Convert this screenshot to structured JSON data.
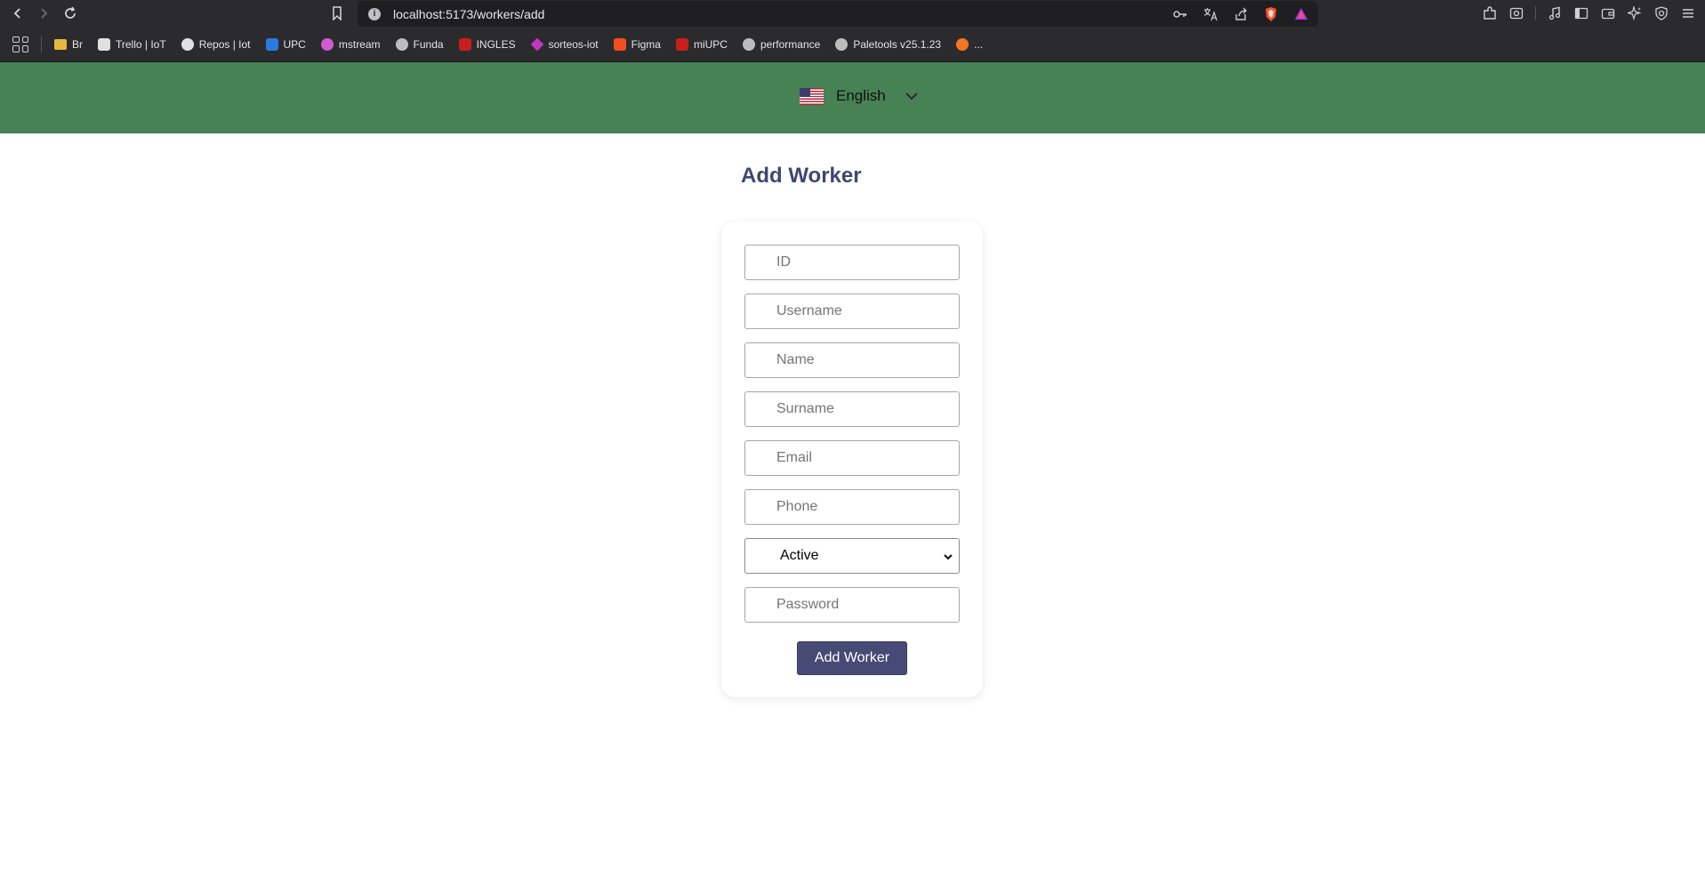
{
  "browser": {
    "url": "localhost:5173/workers/add",
    "bookmarks": [
      {
        "label": "Br",
        "icon": "folder-icon",
        "color": "#e8b83c"
      },
      {
        "label": "Trello | IoT",
        "icon": "trello-icon",
        "color": "#e0e0e0"
      },
      {
        "label": "Repos | Iot",
        "icon": "github-icon",
        "color": "#e0e0e0"
      },
      {
        "label": "UPC",
        "icon": "upc-icon",
        "color": "#2a7ae2"
      },
      {
        "label": "mstream",
        "icon": "mstream-icon",
        "color": "#d05cd0"
      },
      {
        "label": "Funda",
        "icon": "globe-icon",
        "color": "#bdbdbd"
      },
      {
        "label": "INGLES",
        "icon": "upc-red-icon",
        "color": "#c81e1e"
      },
      {
        "label": "sorteos-iot",
        "icon": "diamond-icon",
        "color": "#c236c2"
      },
      {
        "label": "Figma",
        "icon": "figma-icon",
        "color": "#f24e1e"
      },
      {
        "label": "miUPC",
        "icon": "upc-red-icon",
        "color": "#c81e1e"
      },
      {
        "label": "performance",
        "icon": "globe-icon",
        "color": "#bdbdbd"
      },
      {
        "label": "Paletools v25.1.23",
        "icon": "globe-icon",
        "color": "#bdbdbd"
      },
      {
        "label": "...",
        "icon": "crunchyroll-icon",
        "color": "#f47521"
      }
    ]
  },
  "header": {
    "language": "English",
    "bg_color": "#468254"
  },
  "form": {
    "title": "Add Worker",
    "fields": {
      "id": "ID",
      "username": "Username",
      "name": "Name",
      "surname": "Surname",
      "email": "Email",
      "phone": "Phone",
      "password": "Password"
    },
    "status": {
      "selected": "Active"
    },
    "submit_label": "Add Worker",
    "accent_color": "#464a74"
  }
}
